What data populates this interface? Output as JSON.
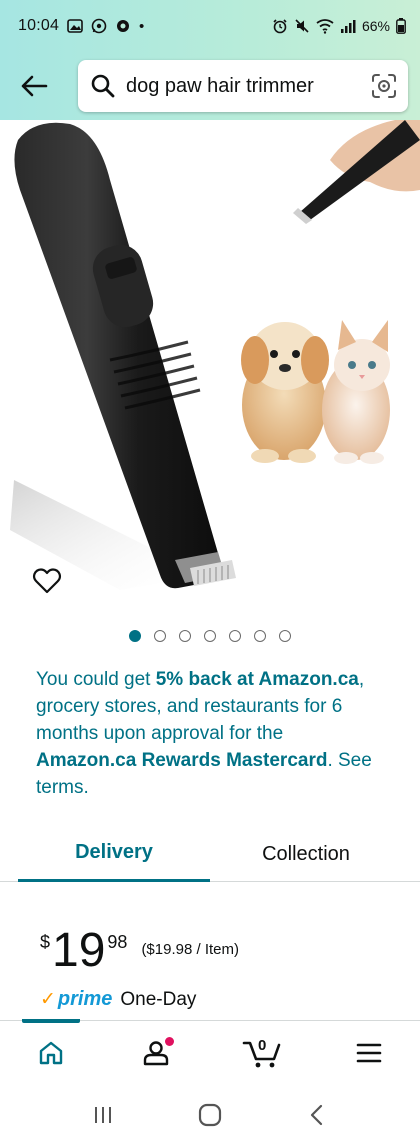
{
  "status_bar": {
    "time": "10:04",
    "battery": "66%",
    "dot": "•"
  },
  "search": {
    "query": "dog paw hair trimmer"
  },
  "gallery": {
    "dot_count": 7,
    "active_index": 0
  },
  "promo": {
    "part1": "You could get ",
    "bold1": "5% back at Amazon.ca",
    "part2": ", grocery stores, and restaurants for 6 months upon approval for the ",
    "bold2": "Amazon.ca Rewards Mastercard",
    "part3": ". See terms."
  },
  "tabs": {
    "delivery": "Delivery",
    "collection": "Collection"
  },
  "price": {
    "symbol": "$",
    "whole": "19",
    "fraction": "98",
    "per_unit": "($19.98 / Item)"
  },
  "prime": {
    "check": "✓",
    "word": "prime",
    "shipping": "One-Day"
  },
  "cart": {
    "count": "0"
  },
  "colors": {
    "accent": "#007185",
    "header_gradient_start": "#a6e6e2",
    "prime_blue": "#1399d6",
    "prime_orange": "#ff9900",
    "notification": "#e0115f"
  },
  "icons": [
    "back-arrow-icon",
    "search-icon",
    "camera-scan-icon",
    "heart-icon",
    "home-icon",
    "account-icon",
    "cart-icon",
    "menu-icon"
  ]
}
